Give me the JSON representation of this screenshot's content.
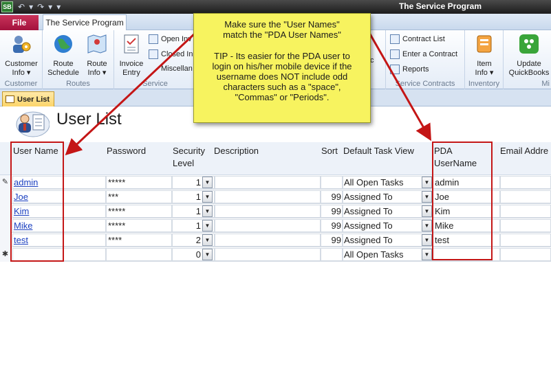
{
  "app": {
    "title": "The Service Program",
    "icon_label": "SB"
  },
  "quick_access": {
    "undo_icon": "undo-icon",
    "redo_icon": "redo-icon",
    "customize_icon": "chevron-down-icon"
  },
  "tabs": {
    "file": "File",
    "home": "The Service Program"
  },
  "ribbon": {
    "customer_group": {
      "label": "Customer",
      "customer_info": [
        "Customer",
        "Info ▾"
      ]
    },
    "routes_group": {
      "label": "Routes",
      "route_schedule": [
        "Route",
        "Schedule"
      ],
      "route_info": [
        "Route",
        "Info ▾"
      ]
    },
    "service_group": {
      "label": "Service",
      "invoice_entry": [
        "Invoice",
        "Entry"
      ],
      "open_inv": "Open Inv",
      "closed_in": "Closed In",
      "miscellan": "Miscellan"
    },
    "contracts_group": {
      "label": "Service Contracts",
      "contract_list": "Contract List",
      "enter_contract": "Enter a Contract",
      "reports": "Reports",
      "partial_c": "c"
    },
    "inventory_group": {
      "label": "Inventory",
      "item_info": [
        "Item",
        "Info ▾"
      ]
    },
    "qb_group": {
      "label": "Mi",
      "update_qb": [
        "Update",
        "QuickBooks"
      ]
    }
  },
  "document_tab": {
    "label": "User List"
  },
  "form": {
    "title": "User List"
  },
  "columns": {
    "user_name": "User Name",
    "password": "Password",
    "security_level": [
      "Security",
      "Level"
    ],
    "description": "Description",
    "sort": "Sort",
    "default_task_view": "Default Task View",
    "pda_username": [
      "PDA",
      "UserName"
    ],
    "email_address": "Email Addre"
  },
  "rows": [
    {
      "selector": "✎",
      "user_name": "admin",
      "password": "*****",
      "security_level": "1",
      "description": "",
      "sort": "",
      "default_task_view": "All Open Tasks",
      "pda_username": "admin"
    },
    {
      "selector": "",
      "user_name": "Joe",
      "password": "***",
      "security_level": "1",
      "description": "",
      "sort": "99",
      "default_task_view": "Assigned To",
      "pda_username": "Joe"
    },
    {
      "selector": "",
      "user_name": "Kim",
      "password": "*****",
      "security_level": "1",
      "description": "",
      "sort": "99",
      "default_task_view": "Assigned To",
      "pda_username": "Kim"
    },
    {
      "selector": "",
      "user_name": "Mike",
      "password": "*****",
      "security_level": "1",
      "description": "",
      "sort": "99",
      "default_task_view": "Assigned To",
      "pda_username": "Mike"
    },
    {
      "selector": "",
      "user_name": "test",
      "password": "****",
      "security_level": "2",
      "description": "",
      "sort": "99",
      "default_task_view": "Assigned To",
      "pda_username": "test"
    }
  ],
  "new_row": {
    "selector": "✱",
    "security_level": "0",
    "default_task_view": "All Open Tasks"
  },
  "callout": {
    "line1": "Make sure the \"User Names\"",
    "line2": "match the \"PDA User Names\"",
    "tip_line1": "TIP - Its easier for the PDA user to",
    "tip_line2": "login on his/her mobile device if the",
    "tip_line3": "username does NOT include odd",
    "tip_line4": "characters such as a \"space\",",
    "tip_line5": "\"Commas\" or \"Periods\"."
  },
  "colors": {
    "highlight_red": "#c41616",
    "note_yellow": "#f7f35f",
    "file_tab": "#a3123d",
    "link_blue": "#1a3fc0"
  }
}
